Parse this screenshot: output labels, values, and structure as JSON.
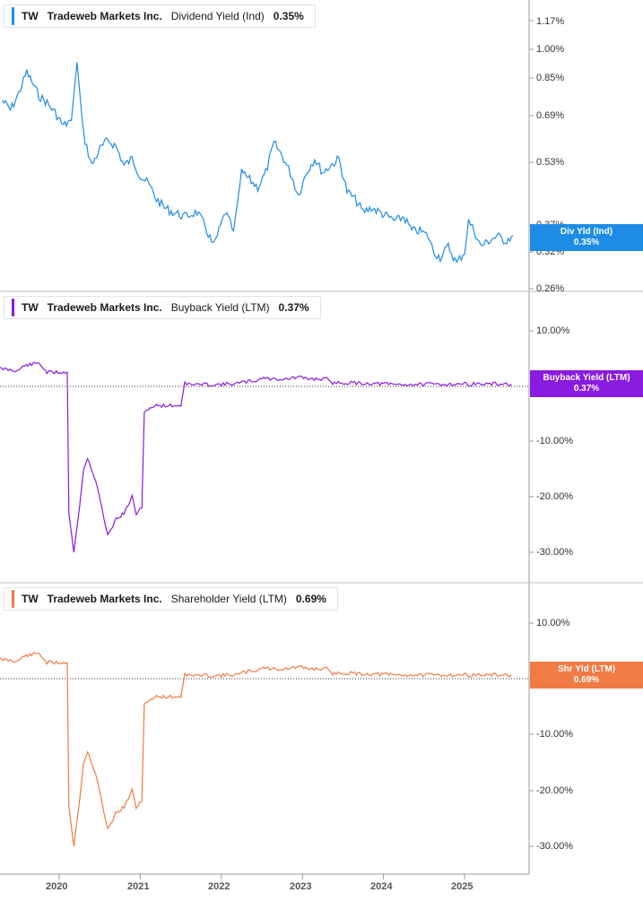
{
  "colors": {
    "div": "#1e8ce6",
    "buyback": "#8a1be0",
    "shareholder": "#f07b45"
  },
  "panels": [
    {
      "ticker": "TW",
      "company": "Tradeweb Markets Inc.",
      "metric": "Dividend Yield (Ind)",
      "value": "0.35%",
      "tag_label": "Div Yld (Ind)",
      "tag_value": "0.35%"
    },
    {
      "ticker": "TW",
      "company": "Tradeweb Markets Inc.",
      "metric": "Buyback Yield (LTM)",
      "value": "0.37%",
      "tag_label": "Buyback Yield (LTM)",
      "tag_value": "0.37%"
    },
    {
      "ticker": "TW",
      "company": "Tradeweb Markets Inc.",
      "metric": "Shareholder Yield (LTM)",
      "value": "0.69%",
      "tag_label": "Shr Yld (LTM)",
      "tag_value": "0.69%"
    }
  ],
  "chart_data": [
    {
      "type": "line",
      "scale": "log",
      "series": [
        {
          "name": "Div Yld (Ind)",
          "x": [
            2019.3,
            2019.4,
            2019.5,
            2019.6,
            2019.75,
            2019.85,
            2019.95,
            2020.05,
            2020.15,
            2020.22,
            2020.3,
            2020.4,
            2020.5,
            2020.6,
            2020.7,
            2020.8,
            2020.9,
            2021.0,
            2021.1,
            2021.2,
            2021.3,
            2021.4,
            2021.55,
            2021.7,
            2021.8,
            2021.9,
            2021.95,
            2022.05,
            2022.15,
            2022.25,
            2022.35,
            2022.45,
            2022.55,
            2022.65,
            2022.75,
            2022.85,
            2022.95,
            2023.05,
            2023.15,
            2023.25,
            2023.35,
            2023.45,
            2023.55,
            2023.65,
            2023.75,
            2023.85,
            2023.95,
            2024.05,
            2024.15,
            2024.25,
            2024.35,
            2024.45,
            2024.55,
            2024.62,
            2024.7,
            2024.8,
            2024.9,
            2025.0,
            2025.05,
            2025.12,
            2025.2,
            2025.3,
            2025.4,
            2025.5,
            2025.6
          ],
          "values": [
            0.75,
            0.71,
            0.78,
            0.88,
            0.77,
            0.74,
            0.7,
            0.65,
            0.67,
            0.93,
            0.62,
            0.52,
            0.57,
            0.6,
            0.58,
            0.52,
            0.54,
            0.49,
            0.47,
            0.43,
            0.41,
            0.4,
            0.39,
            0.4,
            0.37,
            0.33,
            0.35,
            0.4,
            0.36,
            0.5,
            0.48,
            0.46,
            0.5,
            0.59,
            0.55,
            0.5,
            0.44,
            0.5,
            0.54,
            0.5,
            0.52,
            0.54,
            0.45,
            0.43,
            0.4,
            0.41,
            0.4,
            0.39,
            0.38,
            0.39,
            0.36,
            0.36,
            0.35,
            0.32,
            0.31,
            0.33,
            0.3,
            0.32,
            0.38,
            0.36,
            0.33,
            0.34,
            0.35,
            0.34,
            0.35
          ]
        }
      ],
      "ylabels": [
        "1.17%",
        "1.00%",
        "0.85%",
        "0.69%",
        "0.53%",
        "0.37%",
        "0.32%",
        "0.26%"
      ],
      "current": "0.35%"
    },
    {
      "type": "line",
      "series": [
        {
          "name": "Buyback Yield (LTM)",
          "x": [
            2019.2,
            2019.5,
            2019.55,
            2019.75,
            2019.85,
            2020.1,
            2020.12,
            2020.18,
            2020.25,
            2020.3,
            2020.35,
            2020.45,
            2020.5,
            2020.55,
            2020.6,
            2020.7,
            2020.8,
            2020.9,
            2020.95,
            2021.02,
            2021.05,
            2021.1,
            2021.2,
            2021.5,
            2021.55,
            2021.6,
            2022.0,
            2022.2,
            2022.35,
            2022.45,
            2022.5,
            2022.6,
            2022.8,
            2022.95,
            2023.1,
            2023.3,
            2023.35,
            2023.6,
            2023.8,
            2024.0,
            2024.2,
            2025.0,
            2025.58
          ],
          "values": [
            3.3,
            2.8,
            3.6,
            4.2,
            2.5,
            2.5,
            -23,
            -30,
            -22,
            -15,
            -13,
            -17,
            -20,
            -24,
            -27,
            -24,
            -23,
            -20,
            -23,
            -22,
            -5,
            -4,
            -3.5,
            -3.5,
            0.8,
            0.3,
            0.3,
            0.5,
            0.9,
            1.0,
            1.6,
            1.3,
            1.3,
            1.6,
            1.3,
            1.3,
            0.6,
            0.6,
            0.5,
            0.4,
            0.3,
            0.4,
            0.37
          ]
        }
      ],
      "ylim": [
        -34,
        18
      ],
      "ylabels": [
        "10.00%",
        "-10.00%",
        "-20.00%",
        "-30.00%"
      ],
      "current": "0.37%"
    },
    {
      "type": "line",
      "series": [
        {
          "name": "Shareholder Yield (LTM)",
          "x": [
            2019.2,
            2019.5,
            2019.55,
            2019.75,
            2019.85,
            2020.1,
            2020.12,
            2020.18,
            2020.25,
            2020.3,
            2020.35,
            2020.45,
            2020.5,
            2020.55,
            2020.6,
            2020.7,
            2020.8,
            2020.9,
            2020.95,
            2021.02,
            2021.05,
            2021.1,
            2021.2,
            2021.5,
            2021.55,
            2021.6,
            2022.0,
            2022.2,
            2022.35,
            2022.45,
            2022.5,
            2022.6,
            2022.8,
            2022.95,
            2023.1,
            2023.3,
            2023.35,
            2023.6,
            2023.8,
            2024.0,
            2024.2,
            2025.0,
            2025.58
          ],
          "values": [
            3.6,
            3.2,
            4.0,
            4.6,
            2.9,
            2.9,
            -23,
            -30,
            -22,
            -15,
            -13,
            -17,
            -20,
            -24,
            -27,
            -24,
            -23,
            -20,
            -23,
            -22,
            -4.8,
            -3.8,
            -3.2,
            -3.2,
            1.0,
            0.6,
            0.6,
            0.8,
            1.4,
            1.5,
            2.1,
            1.8,
            1.8,
            2.1,
            1.8,
            1.8,
            1.0,
            1.0,
            0.9,
            0.8,
            0.7,
            0.7,
            0.69
          ]
        }
      ],
      "ylim": [
        -34,
        18
      ],
      "ylabels": [
        "10.00%",
        "-10.00%",
        "-20.00%",
        "-30.00%"
      ],
      "current": "0.69%"
    }
  ],
  "x_axis": {
    "labels": [
      "2020",
      "2021",
      "2022",
      "2023",
      "2024",
      "2025"
    ]
  }
}
